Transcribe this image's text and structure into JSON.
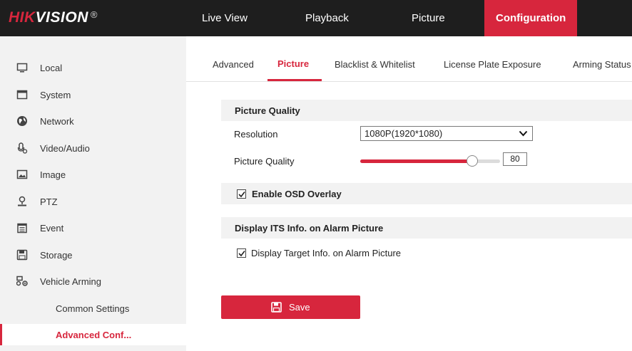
{
  "brand": {
    "hik": "HIK",
    "vision": "VISION",
    "reg": "®"
  },
  "topnav": [
    {
      "label": "Live View"
    },
    {
      "label": "Playback"
    },
    {
      "label": "Picture"
    },
    {
      "label": "Configuration",
      "active": true
    }
  ],
  "sidebar": {
    "items": [
      {
        "label": "Local",
        "icon": "monitor-icon"
      },
      {
        "label": "System",
        "icon": "window-icon"
      },
      {
        "label": "Network",
        "icon": "globe-icon"
      },
      {
        "label": "Video/Audio",
        "icon": "microphone-icon"
      },
      {
        "label": "Image",
        "icon": "image-icon"
      },
      {
        "label": "PTZ",
        "icon": "person-icon"
      },
      {
        "label": "Event",
        "icon": "calendar-icon"
      },
      {
        "label": "Storage",
        "icon": "disk-icon"
      },
      {
        "label": "Vehicle Arming",
        "icon": "vehicle-icon"
      }
    ],
    "sub_items": [
      {
        "label": "Common Settings"
      },
      {
        "label": "Advanced Conf...",
        "active": true
      }
    ]
  },
  "tabs": [
    {
      "label": "Advanced"
    },
    {
      "label": "Picture",
      "active": true
    },
    {
      "label": "Blacklist & Whitelist"
    },
    {
      "label": "License Plate Exposure"
    },
    {
      "label": "Arming Status"
    }
  ],
  "picture_quality": {
    "title": "Picture Quality",
    "resolution_label": "Resolution",
    "resolution_value": "1080P(1920*1080)",
    "quality_label": "Picture Quality",
    "quality_value": "80",
    "quality_fraction": 0.8
  },
  "osd": {
    "label": "Enable OSD Overlay",
    "checked": true
  },
  "its": {
    "title": "Display ITS Info. on Alarm Picture",
    "target_label": "Display Target Info. on Alarm Picture",
    "target_checked": true
  },
  "save": {
    "label": "Save"
  },
  "colors": {
    "accent": "#d7263d",
    "topbar": "#1e1e1e",
    "sidebar": "#f2f2f2"
  }
}
